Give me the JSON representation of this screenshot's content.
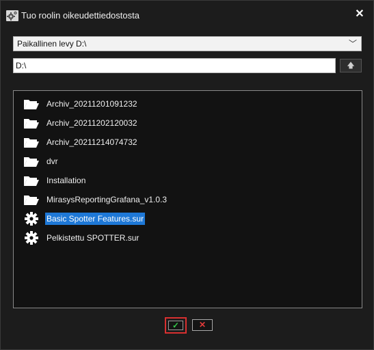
{
  "window": {
    "title": "Tuo roolin oikeudettiedostosta",
    "close_glyph": "✕",
    "icon": "gear-settings-icon"
  },
  "drive_select": {
    "value": "Paikallinen levy D:\\",
    "chevron": "﹀"
  },
  "path": {
    "value": "D:\\",
    "up_glyph": "🡅"
  },
  "file_list": {
    "items": [
      {
        "label": "Archiv_20211201091232",
        "type": "folder",
        "icon": "folder-icon"
      },
      {
        "label": "Archiv_20211202120032",
        "type": "folder",
        "icon": "folder-icon"
      },
      {
        "label": "Archiv_20211214074732",
        "type": "folder",
        "icon": "folder-icon"
      },
      {
        "label": "dvr",
        "type": "folder",
        "icon": "folder-icon"
      },
      {
        "label": "Installation",
        "type": "folder",
        "icon": "folder-icon"
      },
      {
        "label": "MirasysReportingGrafana_v1.0.3",
        "type": "folder",
        "icon": "folder-icon"
      },
      {
        "label": "Basic Spotter Features.sur",
        "type": "file",
        "icon": "gear-icon",
        "selected": true
      },
      {
        "label": "Pelkistettu SPOTTER.sur",
        "type": "file",
        "icon": "gear-icon"
      }
    ]
  },
  "footer": {
    "ok_glyph": "✓",
    "cancel_glyph": "✕"
  },
  "colors": {
    "background": "#1c1c1c",
    "selection": "#1e78d7",
    "ok_check": "#35c84a",
    "cancel_x": "#e23a3a",
    "highlight_border": "#d93030"
  }
}
